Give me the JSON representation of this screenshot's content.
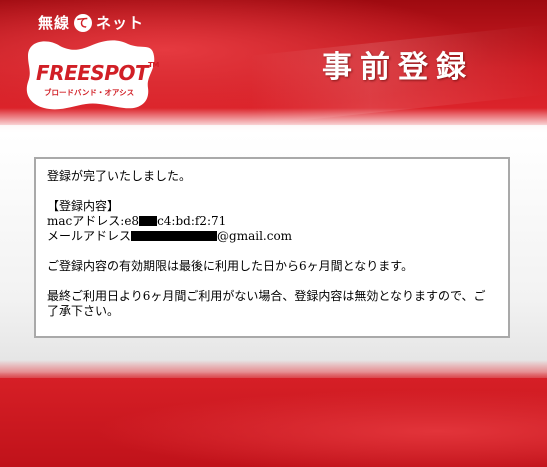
{
  "brand": {
    "top_text_pre": "無線",
    "top_text_circle": "て",
    "top_text_post": "ネット",
    "logo_text": "FREESPOT",
    "logo_tm": "TM",
    "logo_sub": "ブロードバンド・オアシス"
  },
  "header": {
    "title": "事前登録"
  },
  "message": {
    "completed": "登録が完了いたしました。",
    "section_heading": "【登録内容】",
    "mac_label": "macアドレス:",
    "mac_value_start": "e8",
    "mac_value_end": "c4:bd:f2:71",
    "email_label": "メールアドレス",
    "email_domain": "@gmail.com",
    "validity": "ご登録内容の有効期限は最後に利用した日から6ヶ月間となります。",
    "expiry_line1": "最終ご利用日より6ヶ月間ご利用がない場合、登録内容は無効となりますので、ご",
    "expiry_line2": "了承下さい。"
  },
  "colors": {
    "brand_red": "#d11f26",
    "box_border": "#a9a9a9"
  }
}
